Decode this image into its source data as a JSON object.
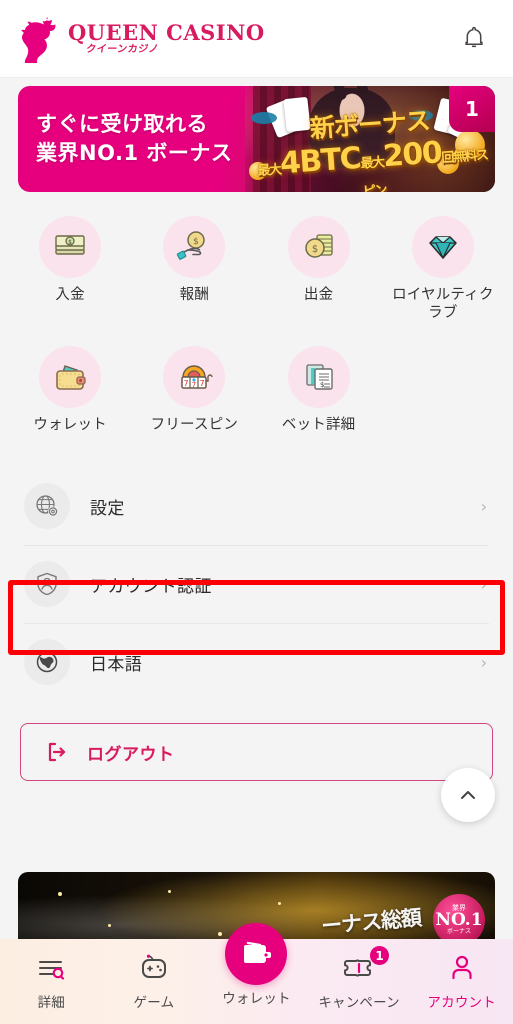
{
  "header": {
    "logo_main": "QUEEN CASINO",
    "logo_sub": "クイーンカジノ",
    "bell_icon": "bell-icon"
  },
  "banner": {
    "line1": "すぐに受け取れる",
    "line2": "業界NO.1 ボーナス",
    "art_line1": "新ボーナス",
    "art_line2_prefix": "最大",
    "art_line2_btc": "4BTC",
    "art_line2_mid": "最大",
    "art_line2_spins": "200",
    "art_line2_suffix": "回無料スピン",
    "badge": "1"
  },
  "grid": {
    "items": [
      {
        "label": "入金",
        "icon": "banknotes-icon"
      },
      {
        "label": "報酬",
        "icon": "hand-coin-icon"
      },
      {
        "label": "出金",
        "icon": "coin-stack-icon"
      },
      {
        "label": "ロイヤルティク\nラブ",
        "icon": "diamond-icon"
      },
      {
        "label": "ウォレット",
        "icon": "wallet-icon"
      },
      {
        "label": "フリースピン",
        "icon": "slot-machine-icon"
      },
      {
        "label": "ベット詳細",
        "icon": "documents-icon"
      }
    ]
  },
  "menu": {
    "rows": [
      {
        "label": "設定",
        "icon": "globe-gear-icon",
        "chevron": "›"
      },
      {
        "label": "アカウント認証",
        "icon": "shield-person-icon",
        "chevron": "›"
      },
      {
        "label": "日本語",
        "icon": "globe-icon",
        "chevron": "›"
      }
    ],
    "highlight_color": "#fb0007",
    "highlighted_row": "アカウント認証"
  },
  "logout": {
    "label": "ログアウト",
    "icon": "logout-icon"
  },
  "scroll_top": {
    "icon": "chevron-up-icon"
  },
  "bottom_banner": {
    "text": "ーナス総額",
    "seal_top": "業界",
    "seal_mid": "NO.1",
    "seal_bottom": "ボーナス"
  },
  "bottom_nav": {
    "items": [
      {
        "label": "詳細",
        "icon": "menu-search-icon",
        "active": false,
        "badge": ""
      },
      {
        "label": "ゲーム",
        "icon": "gamepad-icon",
        "active": false,
        "badge": ""
      },
      {
        "label": "ウォレット",
        "icon": "wallet-icon",
        "active": false,
        "badge": "",
        "center": true
      },
      {
        "label": "キャンペーン",
        "icon": "ticket-icon",
        "active": false,
        "badge": "1"
      },
      {
        "label": "アカウント",
        "icon": "person-icon",
        "active": true,
        "badge": ""
      }
    ]
  },
  "colors": {
    "brand_pink": "#e6007e",
    "logo_pink": "#d81b60",
    "highlight_red": "#fb0007",
    "icon_bg": "#fbe3ee",
    "page_bg": "#f4f4f4"
  }
}
